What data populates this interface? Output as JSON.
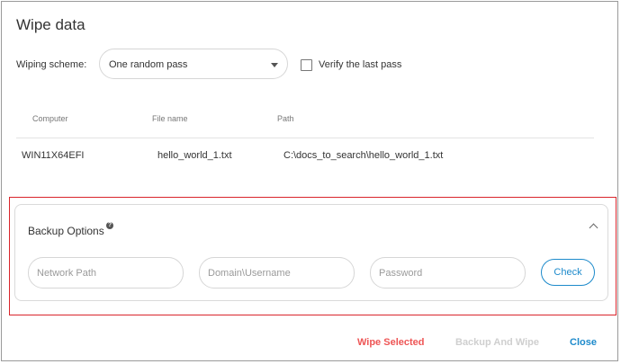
{
  "dialog": {
    "title": "Wipe data"
  },
  "scheme": {
    "label": "Wiping scheme:",
    "selected": "One random pass",
    "verify_label": "Verify the last pass",
    "verify_checked": false
  },
  "table": {
    "columns": [
      "Computer",
      "File name",
      "Path"
    ],
    "rows": [
      [
        "WIN11X64EFI",
        "hello_world_1.txt",
        "C:\\docs_to_search\\hello_world_1.txt"
      ]
    ]
  },
  "backup": {
    "title": "Backup Options",
    "help_glyph": "?",
    "network_path_placeholder": "Network Path",
    "domain_username_placeholder": "Domain\\Username",
    "password_placeholder": "Password",
    "check_label": "Check"
  },
  "footer": {
    "wipe_selected": "Wipe Selected",
    "backup_and_wipe": "Backup And Wipe",
    "close": "Close"
  },
  "colors": {
    "accent": "#1d8acb",
    "danger": "#ee5555",
    "highlight_border": "#d9252b",
    "disabled": "#cfcfcf"
  },
  "icons": {
    "dropdown": "chevron-down-icon",
    "help": "help-icon",
    "collapse": "chevron-up-icon"
  }
}
